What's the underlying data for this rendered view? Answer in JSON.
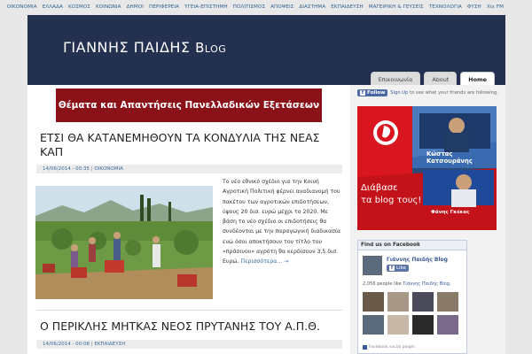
{
  "topnav": {
    "items": [
      "ΟΙΚΟΝΟΜΙΑ",
      "ΕΛΛΑΔΑ",
      "ΚΟΣΜΟΣ",
      "ΚΟΙΝΩΝΙΑ",
      "ΔΗΜΟΙ",
      "ΠΕΡΙΦΕΡΕΙΑ",
      "ΥΓΕΙΑ-ΕΠΙΣΤΗΜΗ",
      "ΠΟΛΙΤΙΣΜΟΣ",
      "ΑΠΟΨΕΙΣ",
      "ΔΙΑΣΤΗΜΑ",
      "ΕΚΠΑΙΔΕΥΣΗ",
      "ΜΑΓΕΙΡΙΚΗ & ΓΕΥΣΕΙΣ",
      "ΤΕΧΝΟΛΟΓΙΑ",
      "ΦΥΣΗ",
      "Xix FM"
    ]
  },
  "header": {
    "title_main": "ΓΙΑΝΝΗΣ ΠΑΙΔΗΣ",
    "title_blog": "Blog",
    "tabs": [
      "Επικοινωνία",
      "About",
      "Home"
    ],
    "active_tab": "Home"
  },
  "colors": {
    "header_bg": "#233050",
    "banner_bg": "#8b1118",
    "link": "#3a6a9a",
    "ad_red": "#d9161f"
  },
  "banner": {
    "text": "Θέματα και Απαντήσεις Πανελλαδικών Εξετάσεων"
  },
  "posts": [
    {
      "title": "ΕΤΣΙ ΘΑ ΚΑΤΑΝΕΜΗΘΟΥΝ ΤΑ ΚΟΝΔΥΛΙΑ ΤΗΣ ΝΕΑΣ ΚΑΠ",
      "date": "14/06/2014 - 00:35",
      "category": "ΟΙΚΟΝΟΜΙΑ",
      "excerpt": "Το νέο εθνικό σχέδιο για την Κοινή Αγροτική Πολιτική φέρνει αναδιανομή του πακέτου των αγροτικών επιδοτήσεων, ύψους 20 δισ. ευρώ μέχρι το 2020. Με βάση το νέο σχέδιο οι επιδοτήσεις θα συνδέονται με την παραγωγική διαδικασία ενώ όσοι αποκτήσουν τον τίτλο του «πράσινου» αγρότη θα κερδίσουν 3,5 δισ. Ευρώ.",
      "more": "Περισσότερα... →"
    },
    {
      "title": "Ο ΠΕΡΙΚΛΗΣ ΜΗΤΚΑΣ ΝΕΟΣ ΠΡΥΤΑΝΗΣ ΤΟΥ Α.Π.Θ.",
      "date": "14/06/2014 - 00:08",
      "category": "ΕΚΠΑΙΔΕΥΣΗ"
    }
  ],
  "sidebar": {
    "follow": {
      "button": "Follow",
      "text_link": "Sign Up",
      "text_rest": " to see what your friends are following."
    },
    "ad": {
      "caption1": "Κώστας Κατσουράνης",
      "cta_line1": "Διάβασε",
      "cta_line2": "τα blog τους!",
      "caption2": "Φάνης Γκέκας"
    },
    "fb_box": {
      "heading": "Find us on Facebook",
      "page_name": "Γιάννης Παιδής Blog",
      "like_label": "Like",
      "count_text": "2,056 people like",
      "count_link": "Γιάννης Παιδής Blog.",
      "plugin_text": "Facebook social plugin"
    }
  }
}
